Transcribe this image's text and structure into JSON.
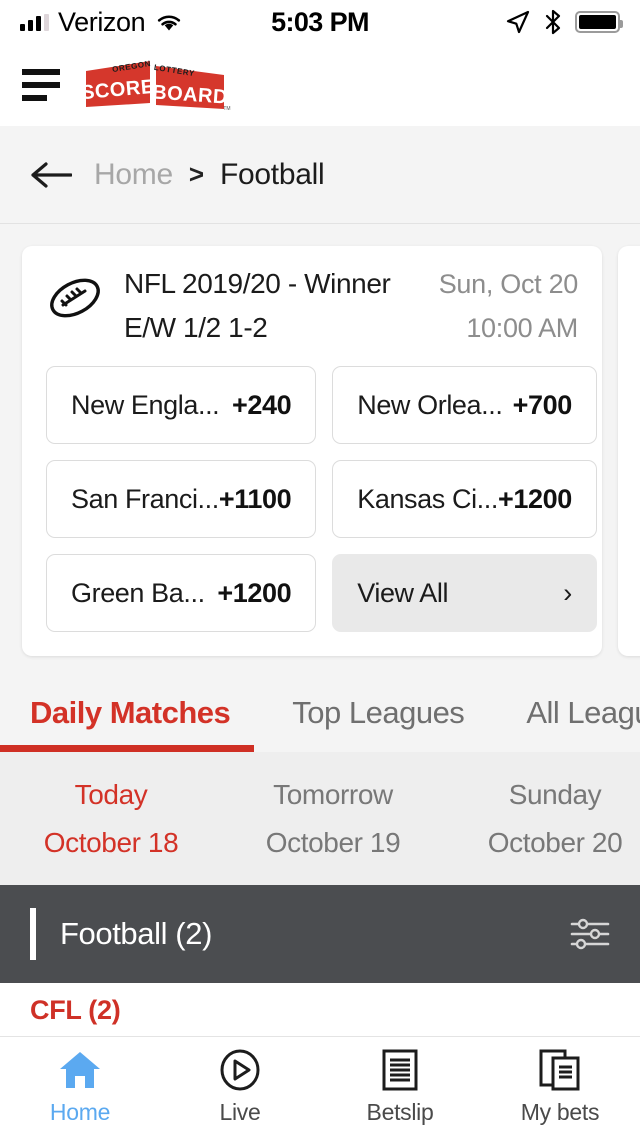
{
  "status_bar": {
    "carrier": "Verizon",
    "time": "5:03 PM",
    "icons": [
      "signal-bars",
      "wifi-icon",
      "location-arrow-icon",
      "bluetooth-icon",
      "battery-icon"
    ]
  },
  "header": {
    "menu_icon": "hamburger-menu-icon",
    "logo_line1": "OREGON",
    "logo_line2": "LOTTERY",
    "logo_word1": "SCORE",
    "logo_word2": "BOARD",
    "logo_tm": "TM"
  },
  "breadcrumb": {
    "back_icon": "back-arrow-icon",
    "home": "Home",
    "separator": ">",
    "current": "Football"
  },
  "featured_card": {
    "sport_icon": "football-icon",
    "title": "NFL 2019/20 - Winner",
    "subtitle": "E/W 1/2 1-2",
    "date": "Sun, Oct 20",
    "time": "10:00 AM",
    "outcomes": [
      {
        "team": "New Engla...",
        "odds": "+240"
      },
      {
        "team": "New Orlea...",
        "odds": "+700"
      },
      {
        "team": "San Franci...",
        "odds": "+1100"
      },
      {
        "team": "Kansas Ci...",
        "odds": "+1200"
      },
      {
        "team": "Green Ba...",
        "odds": "+1200"
      }
    ],
    "view_all": "View All",
    "view_all_chevron": "chevron-right-icon"
  },
  "tabs": [
    {
      "label": "Daily Matches",
      "active": true
    },
    {
      "label": "Top Leagues",
      "active": false
    },
    {
      "label": "All Leagues",
      "active": false
    }
  ],
  "dates": [
    {
      "day": "Today",
      "date": "October 18",
      "active": true
    },
    {
      "day": "Tomorrow",
      "date": "October 19",
      "active": false
    },
    {
      "day": "Sunday",
      "date": "October 20",
      "active": false
    }
  ],
  "sport_section": {
    "name": "Football  (2)",
    "filter_icon": "filter-sliders-icon"
  },
  "league_row": {
    "name": "CFL (2)"
  },
  "bottom_nav": [
    {
      "label": "Home",
      "icon": "home-icon",
      "active": true
    },
    {
      "label": "Live",
      "icon": "live-play-icon",
      "active": false
    },
    {
      "label": "Betslip",
      "icon": "betslip-icon",
      "active": false
    },
    {
      "label": "My bets",
      "icon": "my-bets-icon",
      "active": false
    }
  ],
  "colors": {
    "accent_red": "#cf3127",
    "active_blue": "#5ba9f0",
    "dark_bar": "#4b4d50",
    "page_bg": "#f4f4f4"
  }
}
